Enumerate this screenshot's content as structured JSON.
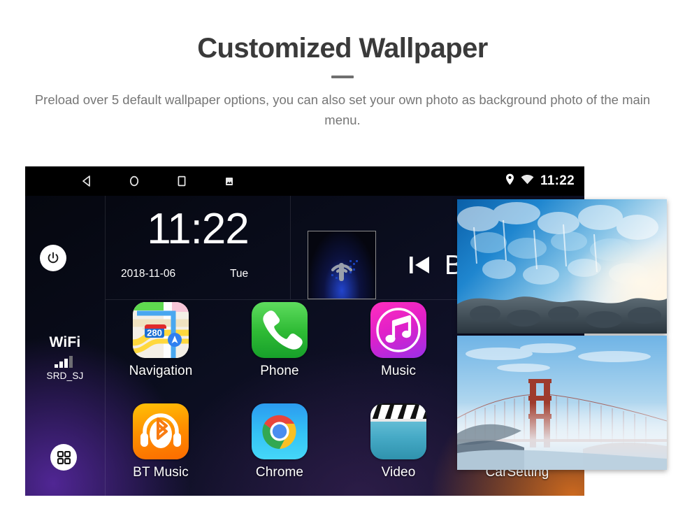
{
  "header": {
    "title": "Customized Wallpaper",
    "subtitle": "Preload over 5 default wallpaper options, you can also set your own photo as background photo of the main menu."
  },
  "device": {
    "statusbar": {
      "nav_icons": [
        "back-icon",
        "home-icon",
        "recents-icon",
        "screenshot-icon"
      ],
      "status_icons": [
        "location-pin-icon",
        "wifi-icon"
      ],
      "clock": "11:22"
    },
    "rail": {
      "power_icon": "power-icon",
      "wifi_label": "WiFi",
      "wifi_signal_icon": "signal-bars-icon",
      "wifi_ssid": "SRD_SJ",
      "apps_icon": "apps-grid-icon"
    },
    "clock_widget": {
      "time": "11:22",
      "date": "2018-11-06",
      "weekday": "Tue"
    },
    "media_widget": {
      "tile_icon": "radio-antenna-icon",
      "prev_icon": "previous-track-icon",
      "text": "B"
    },
    "apps": [
      {
        "label": "Navigation",
        "icon": "maps-icon",
        "shield_number": "280"
      },
      {
        "label": "Phone",
        "icon": "phone-handset-icon"
      },
      {
        "label": "Music",
        "icon": "music-note-icon"
      },
      {
        "label": "BT Music",
        "icon": "bluetooth-headphones-icon"
      },
      {
        "label": "Chrome",
        "icon": "chrome-icon"
      },
      {
        "label": "Video",
        "icon": "clapperboard-icon"
      },
      {
        "label": "CarSetting",
        "icon": "car-setting-icon"
      }
    ],
    "wallpaper_previews": [
      {
        "name": "ice-cave-wallpaper"
      },
      {
        "name": "golden-gate-bridge-wallpaper"
      }
    ]
  },
  "colors": {
    "title": "#3a3a3a",
    "subtitle": "#767676",
    "device_bg": "#000000",
    "phone_green": "#2fbb35",
    "music_magenta": "#e220c8",
    "bt_orange": "#ff9000",
    "chrome_blue": "#35c3f5",
    "video_blue": "#46aac6"
  }
}
